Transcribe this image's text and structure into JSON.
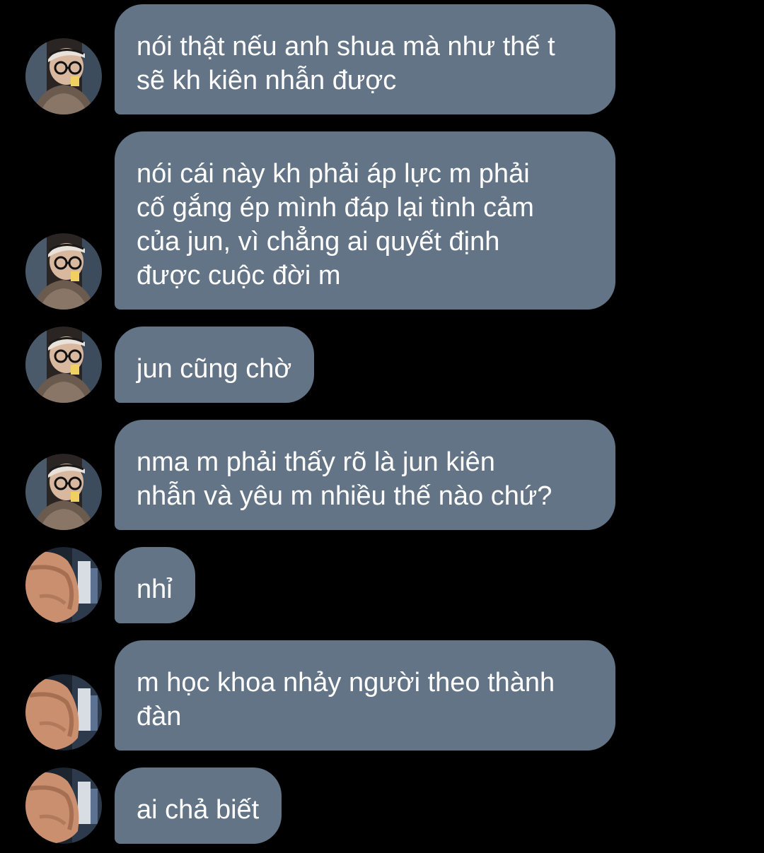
{
  "conversation": {
    "messages": [
      {
        "sender": "contact-a",
        "text": "nói thật nếu anh shua mà như thế t\nsẽ kh kiên nhẫn được"
      },
      {
        "sender": "contact-a",
        "text": "nói cái này kh phải áp lực m phải\ncố gắng ép mình đáp lại tình cảm\ncủa jun, vì chẳng ai quyết định\nđược cuộc đời m"
      },
      {
        "sender": "contact-a",
        "text": "jun cũng chờ"
      },
      {
        "sender": "contact-a",
        "text": "nma m phải thấy rõ là jun kiên\nnhẫn và yêu m nhiều thế nào chứ?"
      },
      {
        "sender": "contact-b",
        "text": "nhỉ"
      },
      {
        "sender": "contact-b",
        "text": "m học khoa nhảy người theo thành\nđàn"
      },
      {
        "sender": "contact-b",
        "text": "ai chả biết"
      }
    ]
  },
  "colors": {
    "background": "#000000",
    "bubble": "#647487",
    "text": "#ffffff"
  }
}
